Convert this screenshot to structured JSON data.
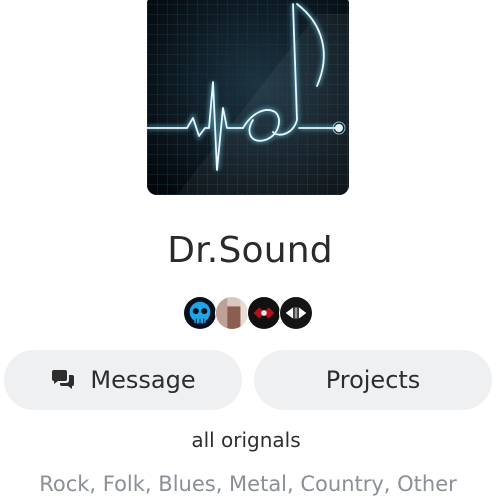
{
  "profile": {
    "image_icon": "heartbeat-music-note-artwork",
    "name": "Dr.Sound",
    "bio": "all orignals",
    "genres": "Rock, Folk, Blues, Metal, Country, Other"
  },
  "mutuals": [
    {
      "icon": "skull-avatar-icon"
    },
    {
      "icon": "photo-avatar-icon"
    },
    {
      "icon": "crest-avatar-icon"
    },
    {
      "icon": "media-controls-avatar-icon"
    }
  ],
  "actions": {
    "message_label": "Message",
    "message_icon": "chat-bubbles-icon",
    "projects_label": "Projects"
  },
  "colors": {
    "accent_glow": "#7fd3ef",
    "button_bg": "#eef0f2",
    "genre_text": "#8a8f98"
  }
}
